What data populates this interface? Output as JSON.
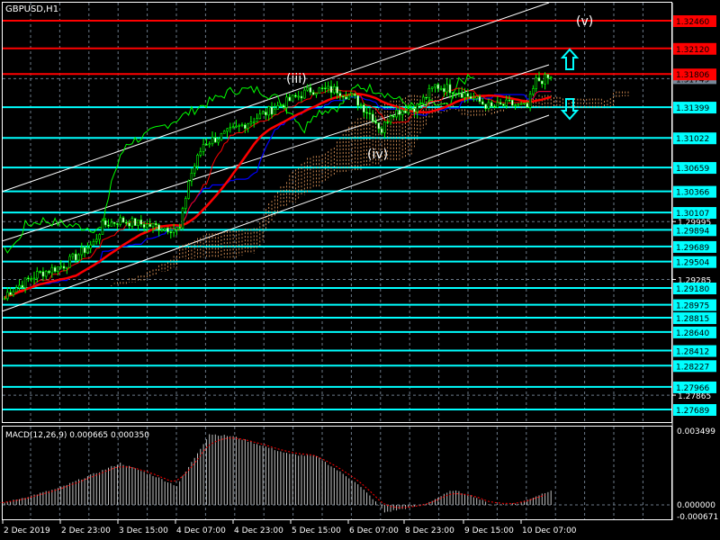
{
  "window": {
    "symbol_label": "GBPUSD,H1"
  },
  "colors": {
    "background": "#000000",
    "resistance": "#ff0000",
    "support": "#00ffff",
    "candle": "#00ff00",
    "ma": "#ff0000",
    "kijun": "#0000ff",
    "cloud": "#f4a460",
    "macd_hist": "#c0c0c0",
    "macd_signal": "#ff0000"
  },
  "wave_labels": {
    "iii": "(iii)",
    "iv": "(iv)",
    "v": "(v)"
  },
  "price_axis": {
    "resistance_levels": [
      "1.32460",
      "1.32120",
      "1.31806"
    ],
    "support_levels": [
      "1.31399",
      "1.31022",
      "1.30659",
      "1.30366",
      "1.30107",
      "1.29894",
      "1.29689",
      "1.29504",
      "1.29180",
      "1.28975",
      "1.28815",
      "1.28640",
      "1.28412",
      "1.28227",
      "1.27966",
      "1.27689"
    ],
    "current_price": "1.31749",
    "grid_ticks": [
      "1.29995",
      "1.29285",
      "1.27865"
    ]
  },
  "time_axis": [
    "2 Dec 2019",
    "2 Dec 23:00",
    "3 Dec 15:00",
    "4 Dec 07:00",
    "4 Dec 23:00",
    "5 Dec 15:00",
    "6 Dec 07:00",
    "8 Dec 23:00",
    "9 Dec 15:00",
    "10 Dec 07:00"
  ],
  "macd": {
    "label": "MACD(12,26,9) 0.000665 0.000350",
    "axis_max": "0.003499",
    "axis_zero": "0.000000",
    "axis_min": "-0.000671"
  },
  "chart_data": {
    "type": "candlestick",
    "title": "GBPUSD,H1",
    "ylim": [
      1.2745,
      1.327
    ],
    "close_keypoints_bar_price": [
      [
        0,
        1.2905
      ],
      [
        1,
        1.2912
      ],
      [
        11,
        1.2935
      ],
      [
        20,
        1.2946
      ],
      [
        30,
        1.2973
      ],
      [
        33,
        1.2995
      ],
      [
        39,
        1.3001
      ],
      [
        48,
        1.2995
      ],
      [
        59,
        1.299
      ],
      [
        62,
        1.305
      ],
      [
        67,
        1.3095
      ],
      [
        74,
        1.3106
      ],
      [
        88,
        1.3133
      ],
      [
        91,
        1.3139
      ],
      [
        97,
        1.315
      ],
      [
        103,
        1.3161
      ],
      [
        112,
        1.3161
      ],
      [
        118,
        1.315
      ],
      [
        124,
        1.3128
      ],
      [
        127,
        1.3111
      ],
      [
        130,
        1.3133
      ],
      [
        139,
        1.3141
      ],
      [
        145,
        1.3166
      ],
      [
        152,
        1.3161
      ],
      [
        158,
        1.315
      ],
      [
        164,
        1.3139
      ],
      [
        170,
        1.3144
      ],
      [
        176,
        1.3139
      ],
      [
        179,
        1.3172
      ],
      [
        183,
        1.3175
      ]
    ],
    "macd_hist_keypoints_bar_value": [
      [
        0,
        0.0001
      ],
      [
        18,
        0.00078
      ],
      [
        39,
        0.00198
      ],
      [
        51,
        0.00134
      ],
      [
        58,
        0.0009
      ],
      [
        69,
        0.00336
      ],
      [
        77,
        0.00325
      ],
      [
        96,
        0.0024
      ],
      [
        105,
        0.0023
      ],
      [
        118,
        0.0011
      ],
      [
        124,
        0.0003
      ],
      [
        128,
        -0.00035
      ],
      [
        136,
        -0.00014
      ],
      [
        142,
        7e-05
      ],
      [
        151,
        0.0007
      ],
      [
        158,
        0.0004
      ],
      [
        164,
        0.0
      ],
      [
        173,
        7e-05
      ],
      [
        184,
        0.0007
      ]
    ],
    "macd_ylim": [
      -0.000671,
      0.003499
    ]
  }
}
